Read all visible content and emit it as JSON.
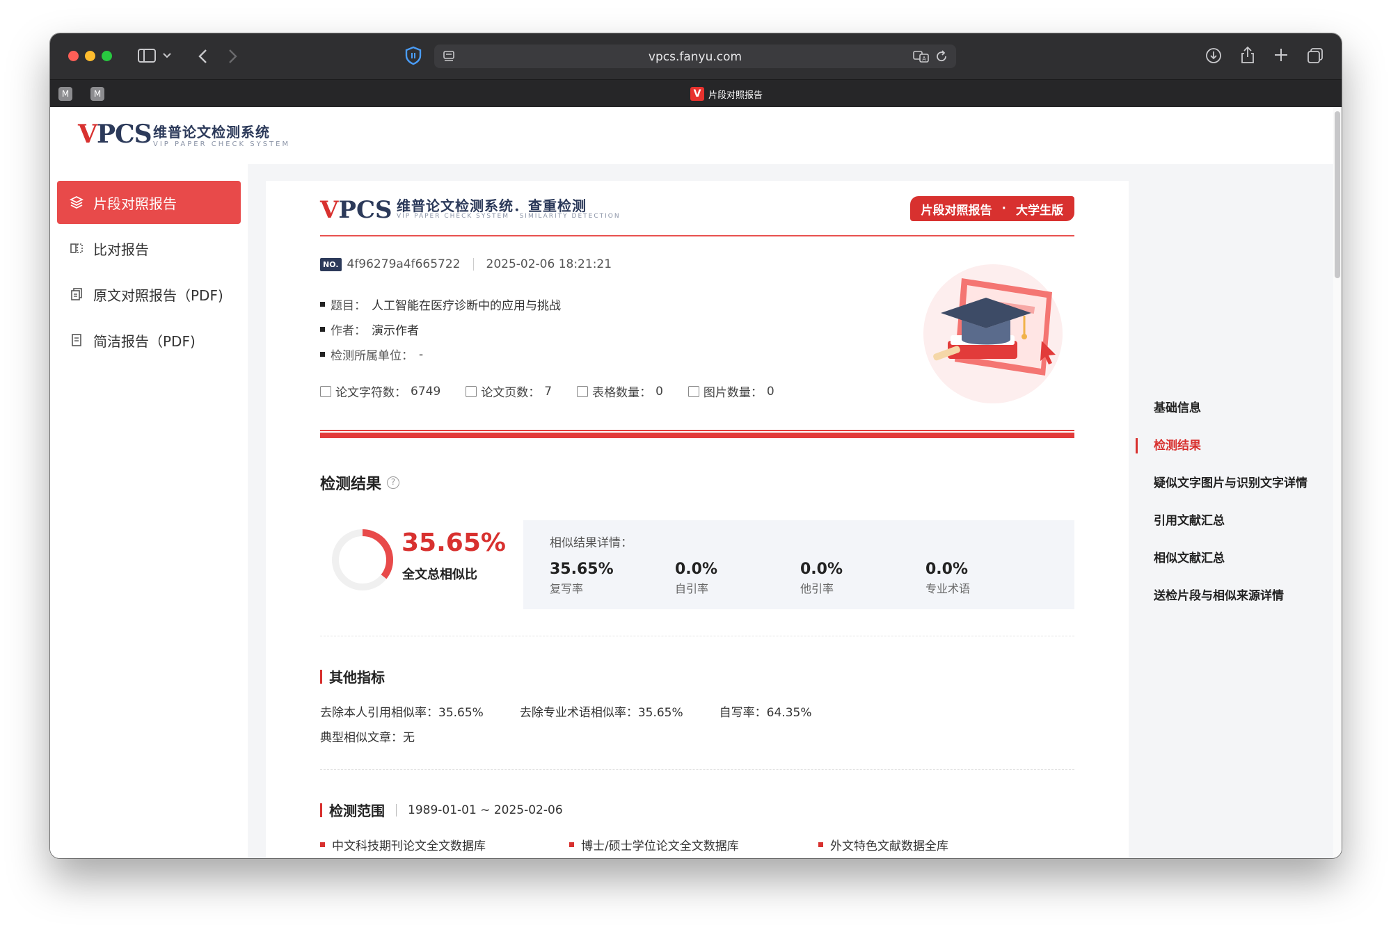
{
  "browser": {
    "url": "vpcs.fanyu.com",
    "tab_title": "片段对照报告",
    "tab_icon": "V",
    "mini_tabs": [
      "M",
      "M"
    ]
  },
  "site": {
    "logo_mark_v": "V",
    "logo_mark_pcs": "PCS",
    "logo_cn": "维普论文检测系统",
    "logo_en": "VIP PAPER CHECK SYSTEM"
  },
  "sidebar": {
    "items": [
      {
        "label": "片段对照报告",
        "icon": "layers-icon"
      },
      {
        "label": "比对报告",
        "icon": "compare-icon"
      },
      {
        "label": "原文对照报告（PDF)",
        "icon": "copy-icon"
      },
      {
        "label": "简洁报告（PDF)",
        "icon": "document-icon"
      }
    ]
  },
  "report": {
    "title_cn": "维普论文检测系统．查重检测",
    "title_en": "VIP PAPER CHECK SYSTEM",
    "title_en_sub": "SIMILARITY DETECTION",
    "badge_left": "片段对照报告",
    "badge_dot": "·",
    "badge_right": "大学生版",
    "no_label": "NO.",
    "report_no": "4f96279a4f665722",
    "datetime": "2025-02-06 18:21:21",
    "info": [
      {
        "label": "题目：",
        "value": "人工智能在医疗诊断中的应用与挑战"
      },
      {
        "label": "作者：",
        "value": "演示作者"
      },
      {
        "label": "检测所属单位：",
        "value": "-"
      }
    ],
    "stats": [
      {
        "label": "论文字符数：",
        "value": "6749"
      },
      {
        "label": "论文页数：",
        "value": "7"
      },
      {
        "label": "表格数量：",
        "value": "0"
      },
      {
        "label": "图片数量：",
        "value": "0"
      }
    ],
    "result": {
      "section_title": "检测结果",
      "help_icon": "?",
      "total_pct": "35.65%",
      "total_fraction": 0.3565,
      "total_label": "全文总相似比",
      "detail_title": "相似结果详情：",
      "details": [
        {
          "value": "35.65%",
          "label": "复写率"
        },
        {
          "value": "0.0%",
          "label": "自引率"
        },
        {
          "value": "0.0%",
          "label": "他引率"
        },
        {
          "value": "0.0%",
          "label": "专业术语"
        }
      ]
    },
    "other": {
      "title": "其他指标",
      "metrics": [
        {
          "label": "去除本人引用相似率：",
          "value": "35.65%"
        },
        {
          "label": "去除专业术语相似率：",
          "value": "35.65%"
        },
        {
          "label": "自写率：",
          "value": "64.35%"
        }
      ],
      "typical_label": "典型相似文章：",
      "typical_value": "无"
    },
    "range": {
      "title": "检测范围",
      "value": "1989-01-01 ~ 2025-02-06",
      "databases": [
        "中文科技期刊论文全文数据库",
        "博士/硕士学位论文全文数据库",
        "外文特色文献数据全库"
      ]
    }
  },
  "right_nav": {
    "items": [
      {
        "label": "基础信息",
        "active": false
      },
      {
        "label": "检测结果",
        "active": true
      },
      {
        "label": "疑似文字图片与识别文字详情",
        "active": false
      },
      {
        "label": "引用文献汇总",
        "active": false
      },
      {
        "label": "相似文献汇总",
        "active": false
      },
      {
        "label": "送检片段与相似来源详情",
        "active": false
      }
    ]
  },
  "colors": {
    "accent": "#d8312f",
    "sidebar_active": "#e84a4a",
    "brand_navy": "#2c3a5a"
  }
}
